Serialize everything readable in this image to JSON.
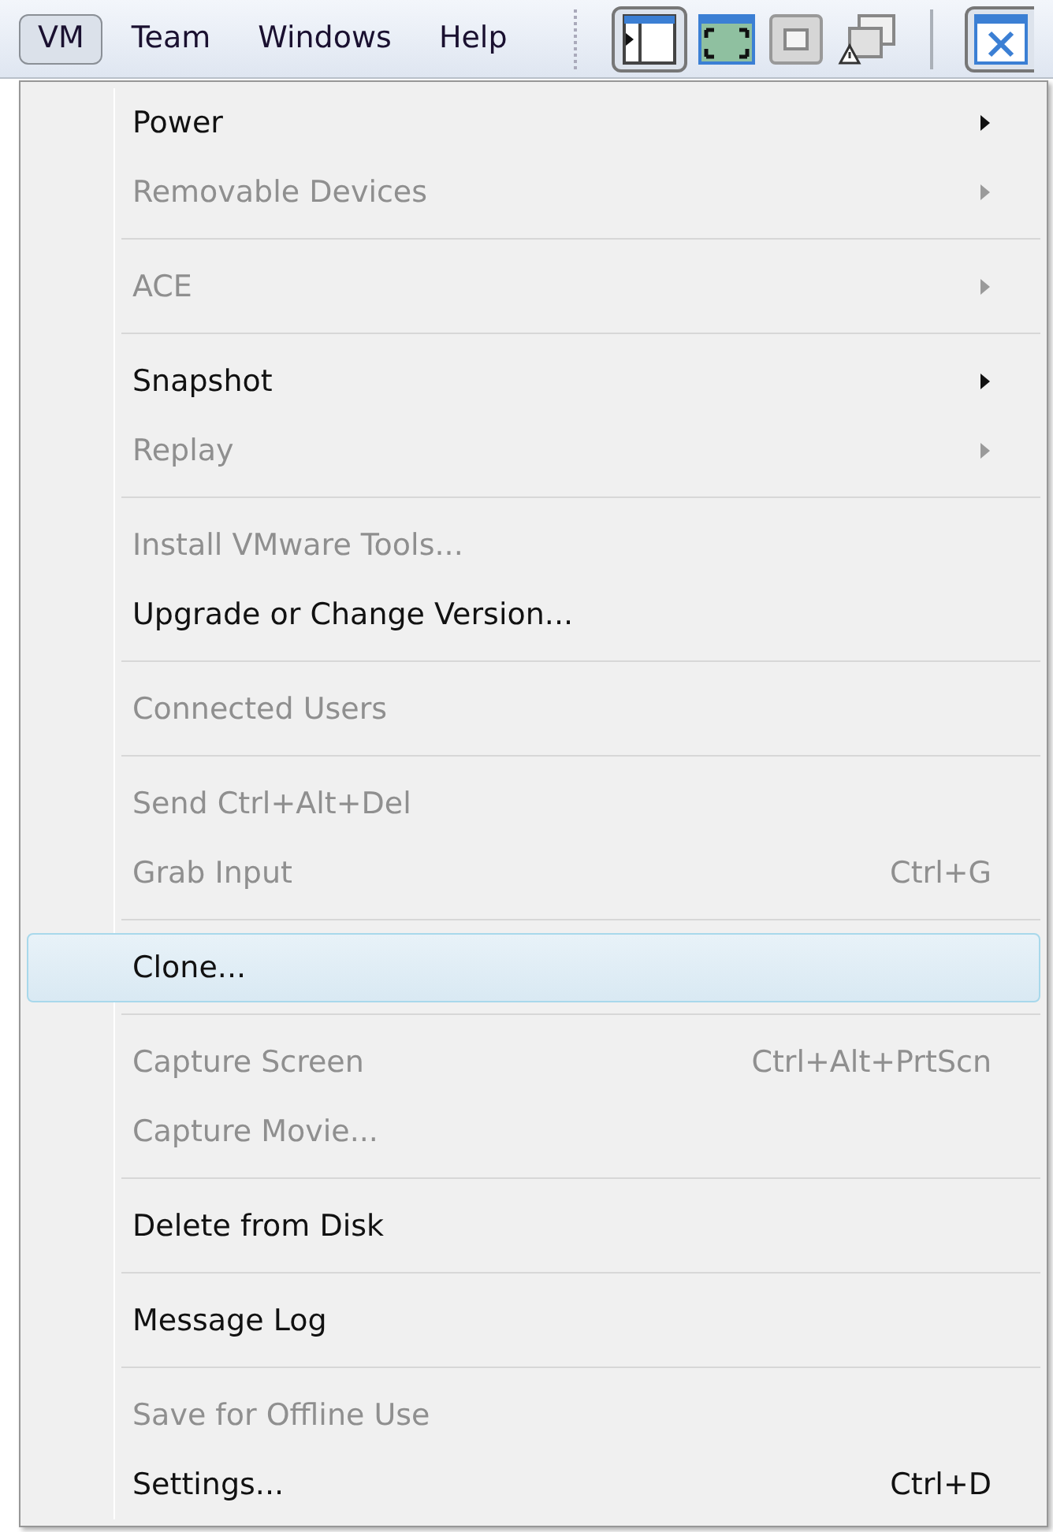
{
  "menu_bar": {
    "items": [
      {
        "label": "VM",
        "selected": true
      },
      {
        "label": "Team",
        "selected": false
      },
      {
        "label": "Windows",
        "selected": false
      },
      {
        "label": "Help",
        "selected": false
      }
    ]
  },
  "menu": {
    "groups": [
      [
        {
          "label": "Power",
          "disabled": false,
          "submenu": true,
          "selected": false
        },
        {
          "label": "Removable Devices",
          "disabled": true,
          "submenu": true,
          "selected": false
        }
      ],
      [
        {
          "label": "ACE",
          "disabled": true,
          "submenu": true,
          "selected": false
        }
      ],
      [
        {
          "label": "Snapshot",
          "disabled": false,
          "submenu": true,
          "selected": false
        },
        {
          "label": "Replay",
          "disabled": true,
          "submenu": true,
          "selected": false
        }
      ],
      [
        {
          "label": "Install VMware Tools...",
          "disabled": true,
          "submenu": false,
          "selected": false
        },
        {
          "label": "Upgrade or Change Version...",
          "disabled": false,
          "submenu": false,
          "selected": false
        }
      ],
      [
        {
          "label": "Connected Users",
          "disabled": true,
          "submenu": false,
          "selected": false
        }
      ],
      [
        {
          "label": "Send Ctrl+Alt+Del",
          "disabled": true,
          "submenu": false,
          "selected": false
        },
        {
          "label": "Grab Input",
          "disabled": true,
          "submenu": false,
          "selected": false,
          "shortcut": "Ctrl+G"
        }
      ],
      [
        {
          "label": "Clone...",
          "disabled": false,
          "submenu": false,
          "selected": true
        }
      ],
      [
        {
          "label": "Capture Screen",
          "disabled": true,
          "submenu": false,
          "selected": false,
          "shortcut": "Ctrl+Alt+PrtScn"
        },
        {
          "label": "Capture Movie...",
          "disabled": true,
          "submenu": false,
          "selected": false
        }
      ],
      [
        {
          "label": "Delete from Disk",
          "disabled": false,
          "submenu": false,
          "selected": false
        }
      ],
      [
        {
          "label": "Message Log",
          "disabled": false,
          "submenu": false,
          "selected": false
        }
      ],
      [
        {
          "label": "Save for Offline Use",
          "disabled": true,
          "submenu": false,
          "selected": false
        },
        {
          "label": "Settings...",
          "disabled": false,
          "submenu": false,
          "selected": false,
          "shortcut": "Ctrl+D"
        }
      ]
    ]
  }
}
